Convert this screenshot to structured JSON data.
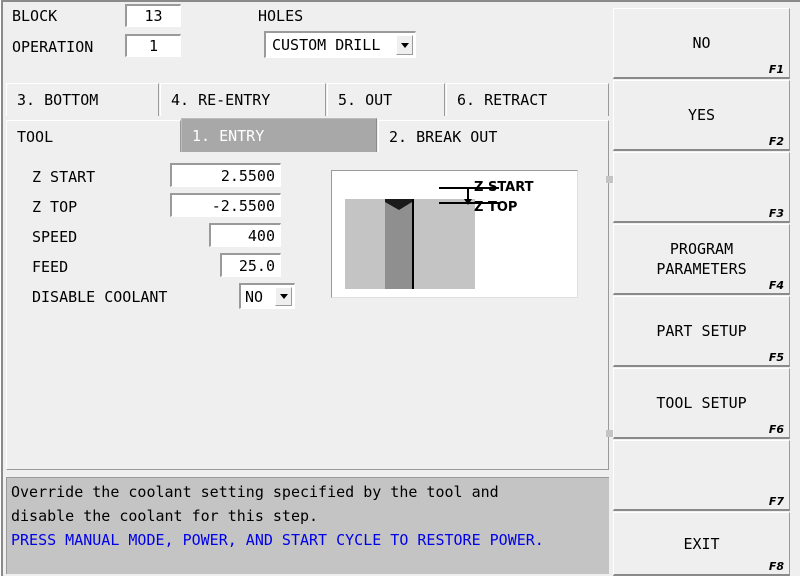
{
  "header": {
    "block_label": "BLOCK",
    "block_value": "13",
    "operation_label": "OPERATION",
    "operation_value": "1",
    "holes_label": "HOLES",
    "holes_value": "CUSTOM DRILL"
  },
  "tabs": {
    "top_row": [
      {
        "label": "3. BOTTOM",
        "selected": false
      },
      {
        "label": "4. RE-ENTRY",
        "selected": false
      },
      {
        "label": "5. OUT",
        "selected": false
      },
      {
        "label": "6. RETRACT",
        "selected": false
      }
    ],
    "bottom_row": [
      {
        "label": "TOOL",
        "selected": false
      },
      {
        "label": "1. ENTRY",
        "selected": true
      },
      {
        "label": "2. BREAK OUT",
        "selected": false
      }
    ]
  },
  "form": {
    "fields": [
      {
        "label": "Z START",
        "value": "2.5500",
        "type": "text"
      },
      {
        "label": "Z TOP",
        "value": "-2.5500",
        "type": "text"
      },
      {
        "label": "SPEED",
        "value": "400",
        "type": "text"
      },
      {
        "label": "FEED",
        "value": "25.0",
        "type": "text"
      },
      {
        "label": "DISABLE COOLANT",
        "value": "NO",
        "type": "combo"
      }
    ]
  },
  "diagram": {
    "label_z_start": "Z START",
    "label_z_top": "Z TOP"
  },
  "status": {
    "help_line_1": "Override the coolant setting specified by the tool and",
    "help_line_2": "disable the coolant for this step.",
    "message": "PRESS MANUAL MODE, POWER, AND START CYCLE TO RESTORE POWER."
  },
  "function_keys": [
    {
      "label": "NO",
      "key": "F1"
    },
    {
      "label": "YES",
      "key": "F2"
    },
    {
      "label": "",
      "key": "F3"
    },
    {
      "label": "PROGRAM\nPARAMETERS",
      "key": "F4"
    },
    {
      "label": "PART SETUP",
      "key": "F5"
    },
    {
      "label": "TOOL SETUP",
      "key": "F6"
    },
    {
      "label": "",
      "key": "F7"
    },
    {
      "label": "EXIT",
      "key": "F8"
    }
  ],
  "colors": {
    "face": "#efefef",
    "status_bg": "#c4c4c4",
    "selected_tab": "#a8a8a8",
    "message_blue": "#0000e6",
    "stock": "#c4c4c4",
    "hole": "#8f8f8f"
  }
}
